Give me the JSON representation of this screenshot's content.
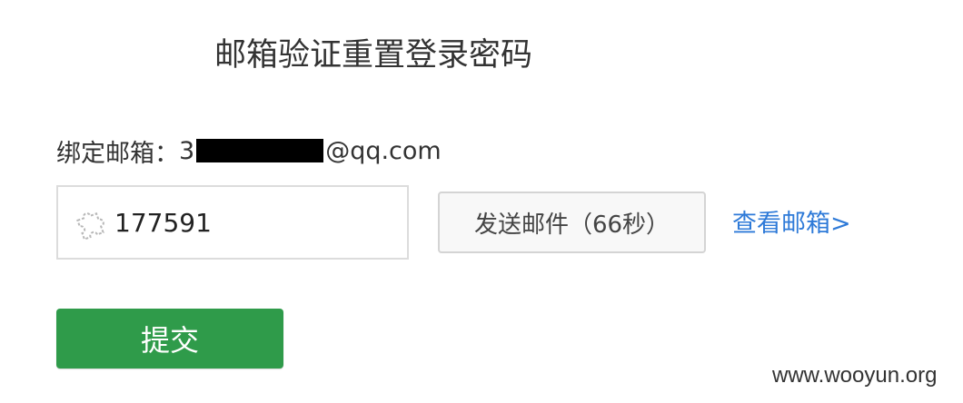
{
  "page": {
    "title": "邮箱验证重置登录密码"
  },
  "email": {
    "label": "绑定邮箱：",
    "prefix": "3",
    "domain": "@qq.com"
  },
  "code_field": {
    "icon": "puzzle-icon",
    "value": "177591"
  },
  "send_button": {
    "label": "发送邮件（66秒）"
  },
  "view_mail_link": {
    "label": "查看邮箱>"
  },
  "submit_button": {
    "label": "提交"
  },
  "watermark": {
    "text": "www.wooyun.org"
  },
  "colors": {
    "primary_green": "#2f9b4a",
    "link_blue": "#2e7ad8",
    "border_gray": "#dcdcdc"
  }
}
